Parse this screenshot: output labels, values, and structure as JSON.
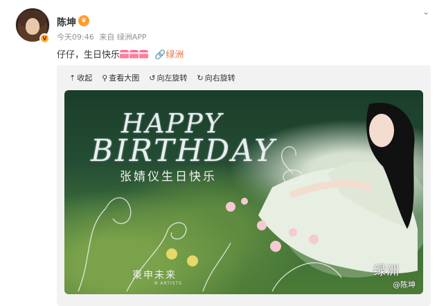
{
  "post": {
    "author": {
      "name": "陈坤",
      "avatar_icon": "user-avatar",
      "verify_icon": "verified-badge-icon",
      "vip_icon": "vip-crown-icon"
    },
    "meta": {
      "time": "今天09:46",
      "source": "来自 绿洲APP"
    },
    "text": {
      "body": "仔仔，生日快乐",
      "emoji": [
        "cake-icon",
        "cake-icon",
        "cake-icon"
      ],
      "link_label": "绿洲"
    },
    "menu_icon": "chevron-down-icon"
  },
  "toolbar": [
    {
      "label": "收起",
      "icon": "collapse-icon"
    },
    {
      "label": "查看大图",
      "icon": "zoom-icon"
    },
    {
      "label": "向左旋转",
      "icon": "rotate-left-icon"
    },
    {
      "label": "向右旋转",
      "icon": "rotate-right-icon"
    }
  ],
  "photo": {
    "title_line1": "HAPPY",
    "title_line2": "BIRTHDAY",
    "greeting": "张婧仪生日快乐",
    "brand": "東申未来",
    "brand_sub": "N ARTISTS",
    "watermark": "绿洲",
    "handle": "@陈坤"
  },
  "colors": {
    "link": "#eb7340",
    "meta": "#939393",
    "vip": "#ff9b2f",
    "verify": "#f6b22b"
  }
}
